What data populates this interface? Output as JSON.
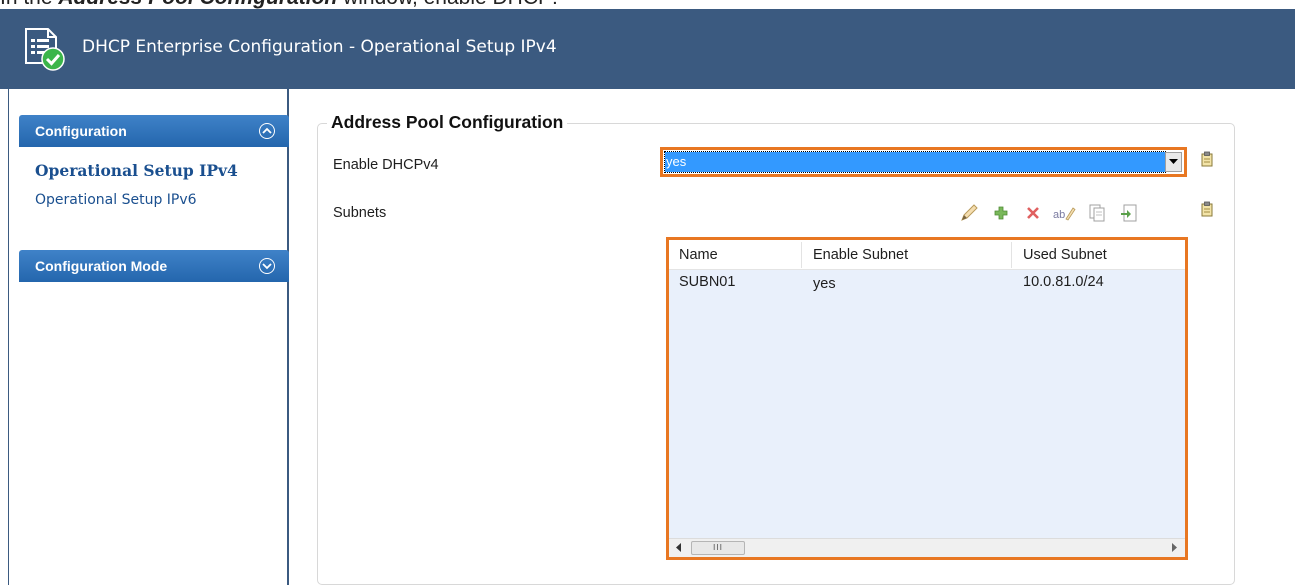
{
  "instruction": {
    "prefix": "In the ",
    "emphasis": "Address Pool Configuration",
    "suffix": " window, enable DHCP:"
  },
  "window": {
    "title": "DHCP Enterprise Configuration - Operational Setup IPv4"
  },
  "sidebar": {
    "configuration_header": "Configuration",
    "items": [
      {
        "label": "Operational Setup IPv4",
        "selected": true
      },
      {
        "label": "Operational Setup IPv6",
        "selected": false
      }
    ],
    "configuration_mode_header": "Configuration Mode"
  },
  "main": {
    "group_title": "Address Pool Configuration",
    "enable_label": "Enable DHCPv4",
    "enable_value": "yes",
    "subnets_label": "Subnets",
    "toolbar_icons": [
      "edit-pencil-icon",
      "add-plus-icon",
      "delete-x-icon",
      "rename-icon",
      "copy-icon",
      "paste-icon"
    ],
    "grid": {
      "columns": [
        "Name",
        "Enable Subnet",
        "Used Subnet"
      ],
      "rows": [
        [
          "SUBN01",
          "yes",
          "10.0.81.0/24"
        ]
      ]
    },
    "scroll_thumb": "III"
  },
  "colors": {
    "titlebar": "#3b5a80",
    "highlight": "#e87722",
    "selection": "#3399ff",
    "panel_header": "#2466ad"
  }
}
